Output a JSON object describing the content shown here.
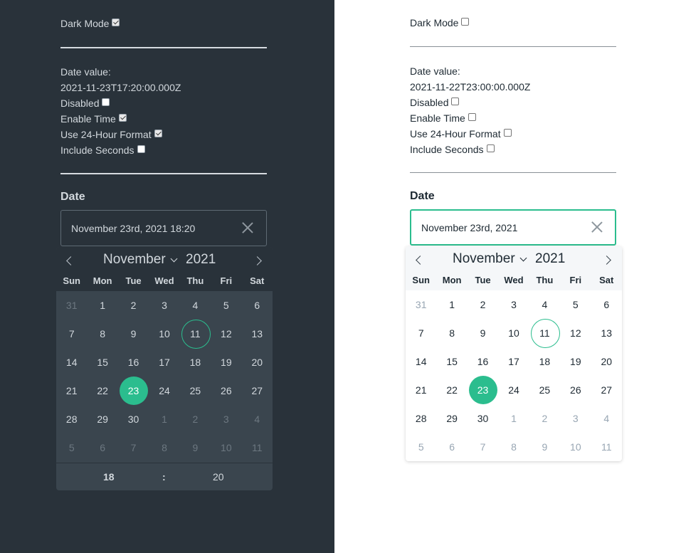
{
  "dark": {
    "dark_mode_label": "Dark Mode",
    "date_value_label": "Date value:",
    "date_value": "2021-11-23T17:20:00.000Z",
    "disabled_label": "Disabled",
    "enable_time_label": "Enable Time",
    "use_24h_label": "Use 24-Hour Format",
    "include_seconds_label": "Include Seconds",
    "date_label": "Date",
    "input_value": "November 23rd, 2021 18:20",
    "calendar": {
      "month": "November",
      "year": "2021",
      "weekdays": [
        "Sun",
        "Mon",
        "Tue",
        "Wed",
        "Thu",
        "Fri",
        "Sat"
      ],
      "weeks": [
        [
          "31",
          "1",
          "2",
          "3",
          "4",
          "5",
          "6"
        ],
        [
          "7",
          "8",
          "9",
          "10",
          "11",
          "12",
          "13"
        ],
        [
          "14",
          "15",
          "16",
          "17",
          "18",
          "19",
          "20"
        ],
        [
          "21",
          "22",
          "23",
          "24",
          "25",
          "26",
          "27"
        ],
        [
          "28",
          "29",
          "30",
          "1",
          "2",
          "3",
          "4"
        ],
        [
          "5",
          "6",
          "7",
          "8",
          "9",
          "10",
          "11"
        ]
      ],
      "hour": "18",
      "separator": ":",
      "minute": "20"
    }
  },
  "light": {
    "dark_mode_label": "Dark Mode",
    "date_value_label": "Date value:",
    "date_value": "2021-11-22T23:00:00.000Z",
    "disabled_label": "Disabled",
    "enable_time_label": "Enable Time",
    "use_24h_label": "Use 24-Hour Format",
    "include_seconds_label": "Include Seconds",
    "date_label": "Date",
    "input_value": "November 23rd, 2021",
    "calendar": {
      "month": "November",
      "year": "2021",
      "weekdays": [
        "Sun",
        "Mon",
        "Tue",
        "Wed",
        "Thu",
        "Fri",
        "Sat"
      ],
      "weeks": [
        [
          "31",
          "1",
          "2",
          "3",
          "4",
          "5",
          "6"
        ],
        [
          "7",
          "8",
          "9",
          "10",
          "11",
          "12",
          "13"
        ],
        [
          "14",
          "15",
          "16",
          "17",
          "18",
          "19",
          "20"
        ],
        [
          "21",
          "22",
          "23",
          "24",
          "25",
          "26",
          "27"
        ],
        [
          "28",
          "29",
          "30",
          "1",
          "2",
          "3",
          "4"
        ],
        [
          "5",
          "6",
          "7",
          "8",
          "9",
          "10",
          "11"
        ]
      ]
    }
  },
  "colors": {
    "accent": "#2bbd8e",
    "dark_bg": "#29323a",
    "dark_calendar_bg": "#3a454e"
  }
}
